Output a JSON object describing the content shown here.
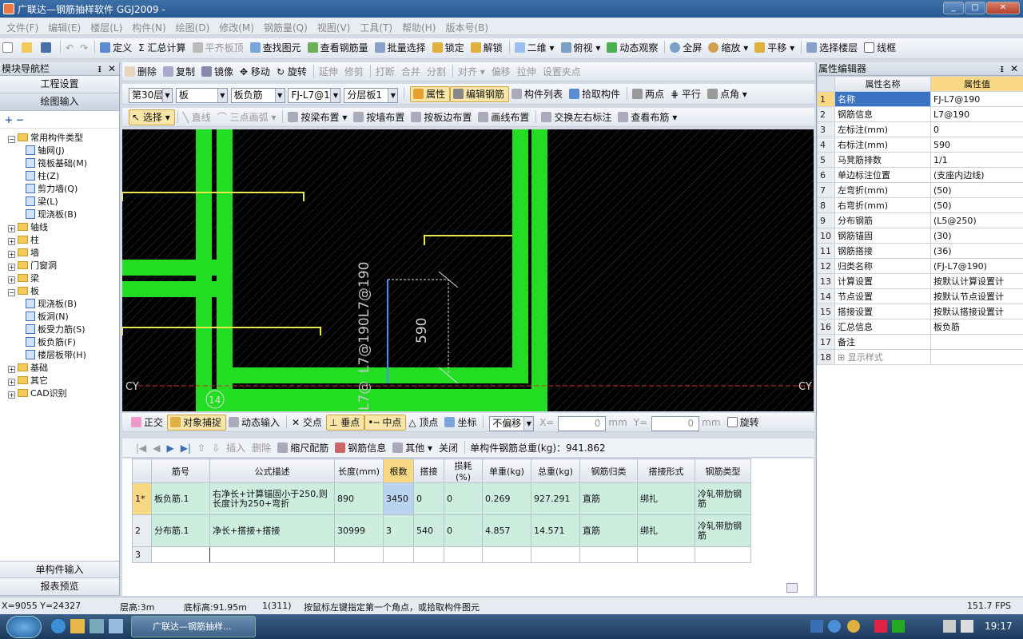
{
  "window": {
    "title": "广联达—钢筋抽样软件 GGJ2009 -",
    "min_label": "_",
    "max_label": "□",
    "close_label": "✕"
  },
  "menu": [
    "文件(F)",
    "编辑(E)",
    "楼层(L)",
    "构件(N)",
    "绘图(D)",
    "修改(M)",
    "钢筋量(Q)",
    "视图(V)",
    "工具(T)",
    "帮助(H)",
    "版本号(B)"
  ],
  "toolbar1": {
    "define": "定义",
    "sum": "汇总计算",
    "flat": "平齐板顶",
    "find": "查找图元",
    "view_rebar": "查看钢筋量",
    "batch": "批量选择",
    "lock": "锁定",
    "unlock": "解锁",
    "view2d": "二维",
    "topview": "俯视",
    "dynamic": "动态观察",
    "fullscreen": "全屏",
    "zoom": "缩放",
    "pan": "平移",
    "select_floor": "选择楼层",
    "wireframe": "线框"
  },
  "toolbar2": {
    "delete": "删除",
    "copy": "复制",
    "mirror": "镜像",
    "move": "移动",
    "rotate": "旋转",
    "extend": "延伸",
    "trim": "修剪",
    "break": "打断",
    "merge": "合并",
    "split": "分割",
    "align": "对齐",
    "offset": "偏移",
    "stretch": "拉伸",
    "set_point": "设置夹点"
  },
  "toolbar3": {
    "floor": "第30层",
    "type": "板",
    "subtype": "板负筋",
    "component": "FJ-L7@190",
    "layer": "分层板1",
    "property": "属性",
    "edit_rebar": "编辑钢筋",
    "list": "构件列表",
    "pick": "拾取构件",
    "two_point": "两点",
    "parallel": "平行",
    "point_angle": "点角"
  },
  "toolbar4": {
    "select": "选择",
    "line": "直线",
    "arc": "三点画弧",
    "by_beam": "按梁布置",
    "by_wall": "按墙布置",
    "by_edge": "按板边布置",
    "draw_line": "画线布置",
    "swap": "交换左右标注",
    "view_layout": "查看布筋"
  },
  "snapbar": {
    "ortho": "正交",
    "snap": "对象捕捉",
    "dyn": "动态输入",
    "intersect": "交点",
    "perp": "垂点",
    "mid": "中点",
    "vertex": "顶点",
    "coord": "坐标",
    "no_offset": "不偏移",
    "x_label": "X=",
    "x_val": "0",
    "unit1": "mm",
    "y_label": "Y=",
    "y_val": "0",
    "unit2": "mm",
    "rotate": "旋转"
  },
  "left": {
    "title": "模块导航栏",
    "pin": "ᵻ",
    "close": "✕",
    "btn_project": "工程设置",
    "btn_draw": "绘图输入",
    "btn_single": "单构件输入",
    "btn_report": "报表预览",
    "tree": [
      {
        "lvl": 0,
        "pm": "−",
        "label": "常用构件类型",
        "kind": "fold"
      },
      {
        "lvl": 1,
        "label": "轴网(J)",
        "kind": "item"
      },
      {
        "lvl": 1,
        "label": "筏板基础(M)",
        "kind": "item"
      },
      {
        "lvl": 1,
        "label": "柱(Z)",
        "kind": "item"
      },
      {
        "lvl": 1,
        "label": "剪力墙(Q)",
        "kind": "item"
      },
      {
        "lvl": 1,
        "label": "梁(L)",
        "kind": "item"
      },
      {
        "lvl": 1,
        "label": "现浇板(B)",
        "kind": "item"
      },
      {
        "lvl": 0,
        "pm": "+",
        "label": "轴线",
        "kind": "fold"
      },
      {
        "lvl": 0,
        "pm": "+",
        "label": "柱",
        "kind": "fold"
      },
      {
        "lvl": 0,
        "pm": "+",
        "label": "墙",
        "kind": "fold"
      },
      {
        "lvl": 0,
        "pm": "+",
        "label": "门窗洞",
        "kind": "fold"
      },
      {
        "lvl": 0,
        "pm": "+",
        "label": "梁",
        "kind": "fold"
      },
      {
        "lvl": 0,
        "pm": "−",
        "label": "板",
        "kind": "fold"
      },
      {
        "lvl": 1,
        "label": "现浇板(B)",
        "kind": "item"
      },
      {
        "lvl": 1,
        "label": "板洞(N)",
        "kind": "item"
      },
      {
        "lvl": 1,
        "label": "板受力筋(S)",
        "kind": "item"
      },
      {
        "lvl": 1,
        "label": "板负筋(F)",
        "kind": "item"
      },
      {
        "lvl": 1,
        "label": "楼层板带(H)",
        "kind": "item"
      },
      {
        "lvl": 0,
        "pm": "+",
        "label": "基础",
        "kind": "fold"
      },
      {
        "lvl": 0,
        "pm": "+",
        "label": "其它",
        "kind": "fold"
      },
      {
        "lvl": 0,
        "pm": "+",
        "label": "CAD识别",
        "kind": "fold"
      }
    ]
  },
  "canvas": {
    "dim_label": "590",
    "rebar_label": "L7@190L7@190",
    "rebar_label2": "L7@",
    "axis_left": "CY",
    "axis_right": "CY",
    "axis_num": "14",
    "colors": {
      "bg": "#000000",
      "beam": "#22dd22",
      "rebar": "#e8e84a",
      "dim": "#cfcfcf",
      "axis": "#cc3333"
    }
  },
  "gridbar": {
    "insert": "插入",
    "delete": "删除",
    "scale": "缩尺配筋",
    "info": "钢筋信息",
    "other": "其他",
    "close": "关闭",
    "total": "单构件钢筋总重(kg)：941.862"
  },
  "grid": {
    "headers": [
      "筋号",
      "公式描述",
      "长度(mm)",
      "根数",
      "搭接",
      "损耗(%)",
      "单重(kg)",
      "总重(kg)",
      "钢筋归类",
      "搭接形式",
      "钢筋类型"
    ],
    "rows": [
      {
        "no": "1*",
        "cells": [
          "板负筋.1",
          "右净长+计算锚固小于250,则长度计为250+弯折",
          "890",
          "3450",
          "0",
          "0",
          "0.269",
          "927.291",
          "直筋",
          "绑扎",
          "冷轧带肋钢筋"
        ]
      },
      {
        "no": "2",
        "cells": [
          "分布筋.1",
          "净长+搭接+搭接",
          "30999",
          "3",
          "540",
          "0",
          "4.857",
          "14.571",
          "直筋",
          "绑扎",
          "冷轧带肋钢筋"
        ]
      },
      {
        "no": "3",
        "cells": [
          "",
          "",
          "",
          "",
          "",
          "",
          "",
          "",
          "",
          "",
          ""
        ]
      }
    ]
  },
  "props": {
    "title": "属性编辑器",
    "col_name": "属性名称",
    "col_value": "属性值",
    "rows": [
      {
        "n": "1",
        "k": "名称",
        "v": "FJ-L7@190"
      },
      {
        "n": "2",
        "k": "钢筋信息",
        "v": "L7@190"
      },
      {
        "n": "3",
        "k": "左标注(mm)",
        "v": "0"
      },
      {
        "n": "4",
        "k": "右标注(mm)",
        "v": "590"
      },
      {
        "n": "5",
        "k": "马凳筋排数",
        "v": "1/1"
      },
      {
        "n": "6",
        "k": "单边标注位置",
        "v": "(支座内边线)"
      },
      {
        "n": "7",
        "k": "左弯折(mm)",
        "v": "(50)"
      },
      {
        "n": "8",
        "k": "右弯折(mm)",
        "v": "(50)"
      },
      {
        "n": "9",
        "k": "分布钢筋",
        "v": "(L5@250)"
      },
      {
        "n": "10",
        "k": "钢筋锚固",
        "v": "(30)"
      },
      {
        "n": "11",
        "k": "钢筋搭接",
        "v": "(36)"
      },
      {
        "n": "12",
        "k": "归类名称",
        "v": "(FJ-L7@190)"
      },
      {
        "n": "13",
        "k": "计算设置",
        "v": "按默认计算设置计"
      },
      {
        "n": "14",
        "k": "节点设置",
        "v": "按默认节点设置计"
      },
      {
        "n": "15",
        "k": "搭接设置",
        "v": "按默认搭接设置计"
      },
      {
        "n": "16",
        "k": "汇总信息",
        "v": "板负筋"
      },
      {
        "n": "17",
        "k": "备注",
        "v": ""
      },
      {
        "n": "18",
        "k": "⊞ 显示样式",
        "v": ""
      }
    ]
  },
  "status": {
    "coords": "X=9055 Y=24327",
    "floor_h": "层高:3m",
    "bottom_h": "底标高:91.95m",
    "count": "1(311)",
    "hint": "按鼠标左键指定第一个角点，或拾取构件图元",
    "fps": "151.7 FPS"
  },
  "taskbar": {
    "app": "广联达—钢筋抽样...",
    "time": "19:17"
  }
}
